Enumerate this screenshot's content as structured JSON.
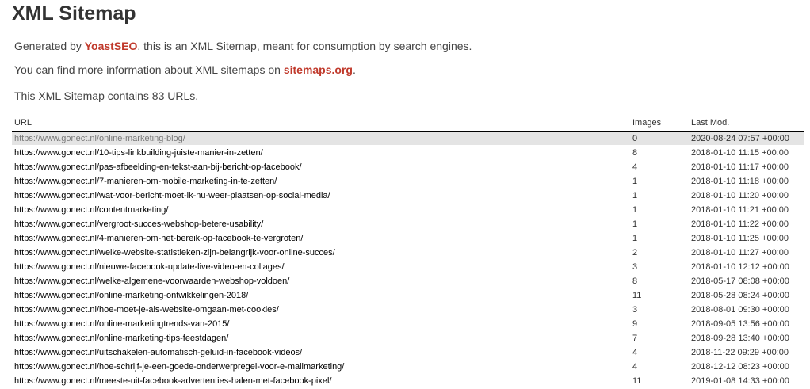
{
  "title": "XML Sitemap",
  "intro": {
    "line1_prefix": "Generated by ",
    "line1_link": "YoastSEO",
    "line1_suffix": ", this is an XML Sitemap, meant for consumption by search engines.",
    "line2_prefix": "You can find more information about XML sitemaps on ",
    "line2_link": "sitemaps.org",
    "line2_suffix": ".",
    "line3": "This XML Sitemap contains 83 URLs."
  },
  "table": {
    "headers": [
      "URL",
      "Images",
      "Last Mod."
    ],
    "rows": [
      {
        "url": "https://www.gonect.nl/online-marketing-blog/",
        "images": "0",
        "lastmod": "2020-08-24 07:57 +00:00"
      },
      {
        "url": "https://www.gonect.nl/10-tips-linkbuilding-juiste-manier-in-zetten/",
        "images": "8",
        "lastmod": "2018-01-10 11:15 +00:00"
      },
      {
        "url": "https://www.gonect.nl/pas-afbeelding-en-tekst-aan-bij-bericht-op-facebook/",
        "images": "4",
        "lastmod": "2018-01-10 11:17 +00:00"
      },
      {
        "url": "https://www.gonect.nl/7-manieren-om-mobile-marketing-in-te-zetten/",
        "images": "1",
        "lastmod": "2018-01-10 11:18 +00:00"
      },
      {
        "url": "https://www.gonect.nl/wat-voor-bericht-moet-ik-nu-weer-plaatsen-op-social-media/",
        "images": "1",
        "lastmod": "2018-01-10 11:20 +00:00"
      },
      {
        "url": "https://www.gonect.nl/contentmarketing/",
        "images": "1",
        "lastmod": "2018-01-10 11:21 +00:00"
      },
      {
        "url": "https://www.gonect.nl/vergroot-succes-webshop-betere-usability/",
        "images": "1",
        "lastmod": "2018-01-10 11:22 +00:00"
      },
      {
        "url": "https://www.gonect.nl/4-manieren-om-het-bereik-op-facebook-te-vergroten/",
        "images": "1",
        "lastmod": "2018-01-10 11:25 +00:00"
      },
      {
        "url": "https://www.gonect.nl/welke-website-statistieken-zijn-belangrijk-voor-online-succes/",
        "images": "2",
        "lastmod": "2018-01-10 11:27 +00:00"
      },
      {
        "url": "https://www.gonect.nl/nieuwe-facebook-update-live-video-en-collages/",
        "images": "3",
        "lastmod": "2018-01-10 12:12 +00:00"
      },
      {
        "url": "https://www.gonect.nl/welke-algemene-voorwaarden-webshop-voldoen/",
        "images": "8",
        "lastmod": "2018-05-17 08:08 +00:00"
      },
      {
        "url": "https://www.gonect.nl/online-marketing-ontwikkelingen-2018/",
        "images": "11",
        "lastmod": "2018-05-28 08:24 +00:00"
      },
      {
        "url": "https://www.gonect.nl/hoe-moet-je-als-website-omgaan-met-cookies/",
        "images": "3",
        "lastmod": "2018-08-01 09:30 +00:00"
      },
      {
        "url": "https://www.gonect.nl/online-marketingtrends-van-2015/",
        "images": "9",
        "lastmod": "2018-09-05 13:56 +00:00"
      },
      {
        "url": "https://www.gonect.nl/online-marketing-tips-feestdagen/",
        "images": "7",
        "lastmod": "2018-09-28 13:40 +00:00"
      },
      {
        "url": "https://www.gonect.nl/uitschakelen-automatisch-geluid-in-facebook-videos/",
        "images": "4",
        "lastmod": "2018-11-22 09:29 +00:00"
      },
      {
        "url": "https://www.gonect.nl/hoe-schrijf-je-een-goede-onderwerpregel-voor-e-mailmarketing/",
        "images": "4",
        "lastmod": "2018-12-12 08:23 +00:00"
      },
      {
        "url": "https://www.gonect.nl/meeste-uit-facebook-advertenties-halen-met-facebook-pixel/",
        "images": "11",
        "lastmod": "2019-01-08 14:33 +00:00"
      }
    ]
  },
  "colors": {
    "link_accent": "#c0392b",
    "highlight_row": "#e4e4e4"
  }
}
